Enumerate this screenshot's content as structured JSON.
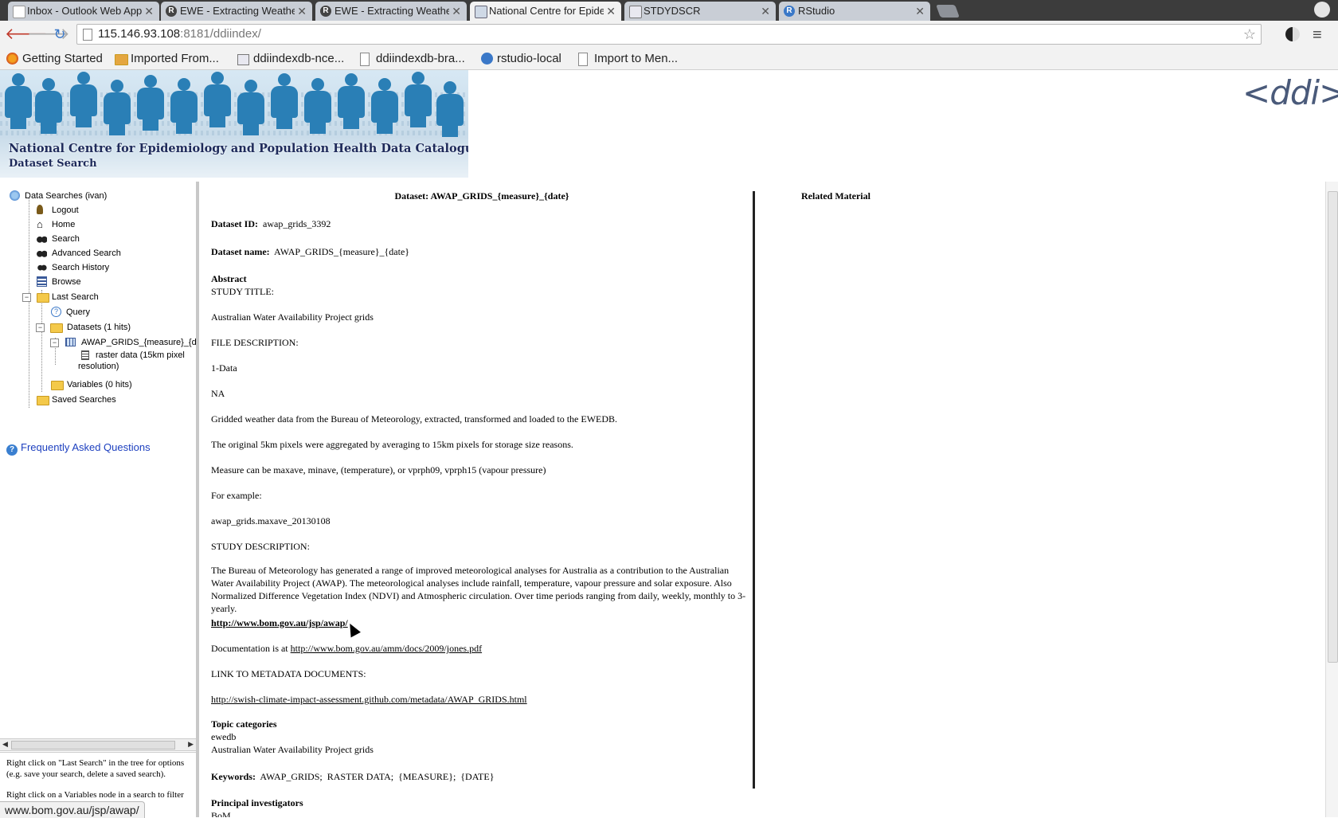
{
  "browser": {
    "tabs": [
      {
        "title": "Inbox - Outlook Web App",
        "favicon": "page-icon"
      },
      {
        "title": "EWE - Extracting Weather",
        "favicon": "r-logo-icon"
      },
      {
        "title": "EWE - Extracting Weather",
        "favicon": "r-logo-icon"
      },
      {
        "title": "National Centre for Epide",
        "favicon": "ncephd-icon",
        "active": true
      },
      {
        "title": "STDYDSCR",
        "favicon": "page-icon"
      },
      {
        "title": "RStudio",
        "favicon": "rstudio-icon"
      }
    ],
    "url_host": "115.146.93.108",
    "url_rest": ":8181/ddiindex/",
    "bookmarks": [
      {
        "label": "Getting Started",
        "icon": "firefox-icon"
      },
      {
        "label": "Imported From...",
        "icon": "folder-icon"
      },
      {
        "label": "ddiindexdb-nce...",
        "icon": "page-icon"
      },
      {
        "label": "ddiindexdb-bra...",
        "icon": "page-icon"
      },
      {
        "label": "rstudio-local",
        "icon": "rstudio-icon"
      },
      {
        "label": "Import to Men...",
        "icon": "page-icon"
      }
    ],
    "status_url": "www.bom.gov.au/jsp/awap/"
  },
  "banner": {
    "title": "National Centre for Epidemiology and Population Health Data Catalogue.",
    "subtitle": "Dataset Search",
    "logo_text": "<ddi>"
  },
  "tree": {
    "root": "Data Searches (ivan)",
    "logout": "Logout",
    "home": "Home",
    "search": "Search",
    "advanced_search": "Advanced Search",
    "search_history": "Search History",
    "browse": "Browse",
    "last_search": "Last Search",
    "query": "Query",
    "datasets": "Datasets (1 hits)",
    "dataset_item": "AWAP_GRIDS_{measure}_{da",
    "raster_line1": "raster data (15km pixel",
    "raster_line2": "resolution)",
    "variables": "Variables (0 hits)",
    "saved_searches": "Saved Searches"
  },
  "faq_label": "Frequently Asked Questions",
  "left_help": [
    "Right click on \"Last Search\" in the tree for options (e.g. save your search, delete a saved search).",
    "Right click on a Variables node in a search to filter"
  ],
  "dataset": {
    "heading": "Dataset: AWAP_GRIDS_{measure}_{date}",
    "id_label": "Dataset ID:",
    "id_value": "awap_grids_3392",
    "name_label": "Dataset name:",
    "name_value": "AWAP_GRIDS_{measure}_{date}",
    "abstract_label": "Abstract",
    "study_title_label": "STUDY TITLE:",
    "study_title": "Australian Water Availability Project grids",
    "file_desc_label": "FILE DESCRIPTION:",
    "file_desc_1": "1-Data",
    "file_desc_2": "NA",
    "para_1": "Gridded weather data from the Bureau of Meteorology, extracted, transformed and loaded to the EWEDB.",
    "para_2": "The original 5km pixels were aggregated by averaging to 15km pixels for storage size reasons.",
    "para_3": "Measure can be maxave, minave, (temperature), or vprph09, vprph15 (vapour pressure)",
    "for_example": "For example:",
    "example": "awap_grids.maxave_20130108",
    "study_desc_label": "STUDY DESCRIPTION:",
    "study_desc": "The Bureau of Meteorology has generated a range of improved meteorological analyses for Australia as a contribution to the Australian Water Availability Project (AWAP). The meteorological analyses include rainfall, temperature, vapour pressure and solar exposure. Also Normalized Difference Vegetation Index (NDVI) and Atmospheric circulation. Over time periods ranging from daily, weekly, monthly to 3-yearly.",
    "bom_link": "http://www.bom.gov.au/jsp/awap/",
    "doc_prefix": "Documentation is at",
    "doc_link": "http://www.bom.gov.au/amm/docs/2009/jones.pdf",
    "metadata_label": "LINK TO METADATA DOCUMENTS:",
    "metadata_link": "http://swish-climate-impact-assessment.github.com/metadata/AWAP_GRIDS.html",
    "topic_label": "Topic categories",
    "topic_1": "ewedb",
    "topic_2": "Australian Water Availability Project grids",
    "keywords_label": "Keywords:",
    "keywords": "AWAP_GRIDS;  RASTER DATA;  {MEASURE};  {DATE}",
    "pi_label": "Principal investigators",
    "pi_value": "BoM"
  },
  "related_label": "Related Material"
}
